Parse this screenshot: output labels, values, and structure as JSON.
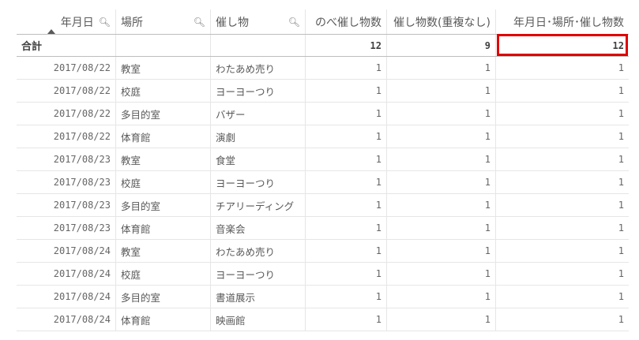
{
  "table": {
    "headers": [
      {
        "label": "年月日",
        "search": true,
        "sorted": true
      },
      {
        "label": "場所",
        "search": true
      },
      {
        "label": "催し物",
        "search": true
      },
      {
        "label": "のべ催し物数",
        "search": false
      },
      {
        "label": "催し物数(重複なし)",
        "search": false
      },
      {
        "label": "年月日･場所･催し物数",
        "search": false
      }
    ],
    "total": {
      "label": "合計",
      "values": [
        "12",
        "9",
        "12"
      ]
    },
    "rows": [
      {
        "date": "2017/08/22",
        "place": "教室",
        "event": "わたあめ売り",
        "v1": "1",
        "v2": "1",
        "v3": "1"
      },
      {
        "date": "2017/08/22",
        "place": "校庭",
        "event": "ヨーヨーつり",
        "v1": "1",
        "v2": "1",
        "v3": "1"
      },
      {
        "date": "2017/08/22",
        "place": "多目的室",
        "event": "バザー",
        "v1": "1",
        "v2": "1",
        "v3": "1"
      },
      {
        "date": "2017/08/22",
        "place": "体育館",
        "event": "演劇",
        "v1": "1",
        "v2": "1",
        "v3": "1"
      },
      {
        "date": "2017/08/23",
        "place": "教室",
        "event": "食堂",
        "v1": "1",
        "v2": "1",
        "v3": "1"
      },
      {
        "date": "2017/08/23",
        "place": "校庭",
        "event": "ヨーヨーつり",
        "v1": "1",
        "v2": "1",
        "v3": "1"
      },
      {
        "date": "2017/08/23",
        "place": "多目的室",
        "event": "チアリーディング",
        "v1": "1",
        "v2": "1",
        "v3": "1"
      },
      {
        "date": "2017/08/23",
        "place": "体育館",
        "event": "音楽会",
        "v1": "1",
        "v2": "1",
        "v3": "1"
      },
      {
        "date": "2017/08/24",
        "place": "教室",
        "event": "わたあめ売り",
        "v1": "1",
        "v2": "1",
        "v3": "1"
      },
      {
        "date": "2017/08/24",
        "place": "校庭",
        "event": "ヨーヨーつり",
        "v1": "1",
        "v2": "1",
        "v3": "1"
      },
      {
        "date": "2017/08/24",
        "place": "多目的室",
        "event": "書道展示",
        "v1": "1",
        "v2": "1",
        "v3": "1"
      },
      {
        "date": "2017/08/24",
        "place": "体育館",
        "event": "映画館",
        "v1": "1",
        "v2": "1",
        "v3": "1"
      }
    ],
    "highlight_color": "#e00000",
    "search_icon": "search-icon"
  }
}
